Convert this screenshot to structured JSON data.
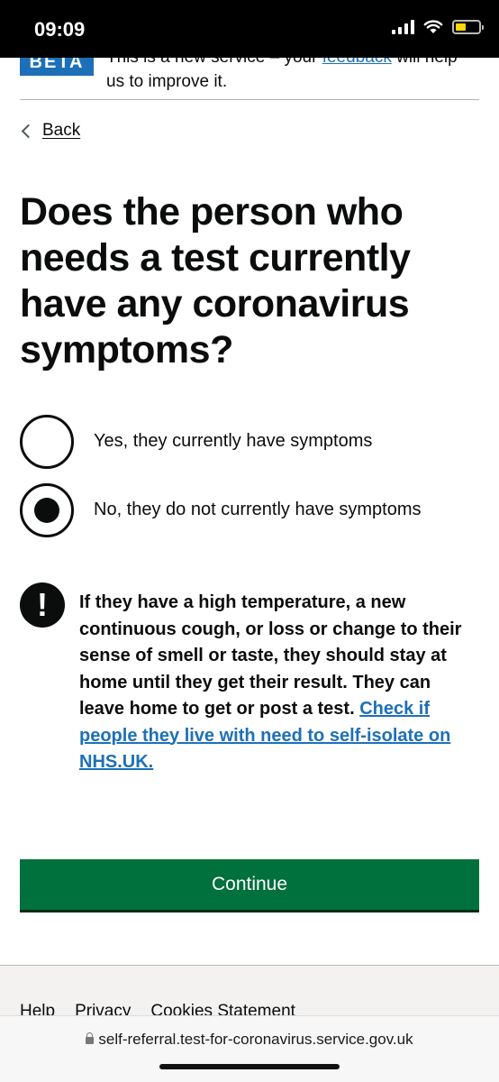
{
  "status_bar": {
    "time": "09:09",
    "icons": [
      "cellular-signal-icon",
      "wifi-icon",
      "battery-icon"
    ],
    "battery_color": "#ffd60a"
  },
  "phase_banner": {
    "tag": "BETA",
    "text_before": "This is a new service – your ",
    "link": "feedback",
    "text_after": " will help us to improve it."
  },
  "back": {
    "label": "Back",
    "icon": "chevron-left-icon"
  },
  "question": {
    "title": "Does the person who needs a test currently have any coronavirus symptoms?"
  },
  "radios": [
    {
      "label": "Yes, they currently have symptoms",
      "checked": false
    },
    {
      "label": "No, they do not currently have symptoms",
      "checked": true
    }
  ],
  "warning": {
    "icon": "!",
    "text": "If they have a high temperature, a new continuous cough, or loss or change to their sense of smell or taste, they should stay at home until they get their result. They can leave home to get or post a test.",
    "link": "Check if people they live with need to self-isolate on NHS.UK."
  },
  "continue_button": {
    "label": "Continue",
    "color": "#00703c"
  },
  "footer": {
    "links": [
      "Help",
      "Privacy",
      "Cookies",
      "Statement"
    ]
  },
  "browser": {
    "url": "self-referral.test-for-coronavirus.service.gov.uk"
  },
  "colors": {
    "link": "#1d70b8",
    "text": "#0b0c0c",
    "tag": "#1d70b8"
  }
}
